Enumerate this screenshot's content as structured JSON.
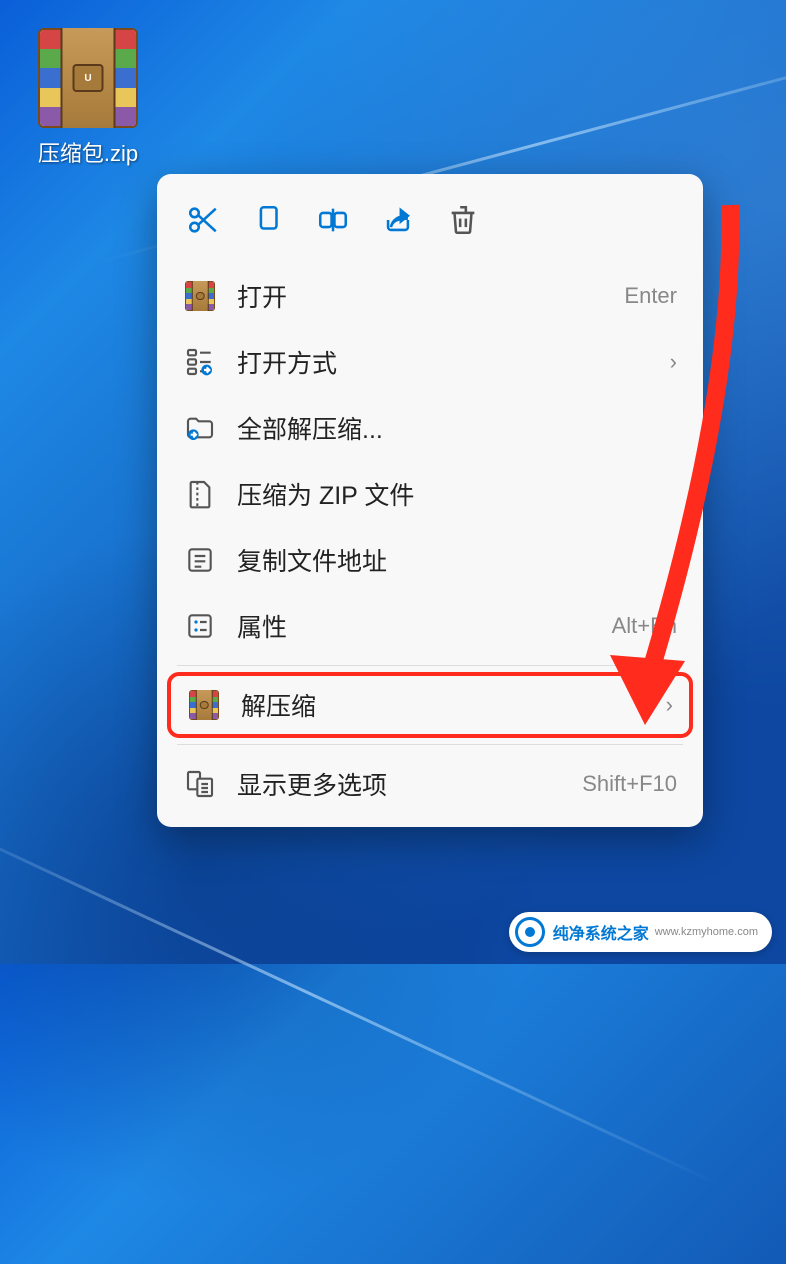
{
  "desktop": {
    "file_label": "压缩包.zip"
  },
  "context_menu": {
    "toolbar": {
      "cut": "cut",
      "copy": "copy",
      "rename": "rename",
      "share": "share",
      "delete": "delete"
    },
    "items": [
      {
        "label": "打开",
        "shortcut": "Enter",
        "icon": "winrar",
        "chevron": false
      },
      {
        "label": "打开方式",
        "shortcut": "",
        "icon": "openwith",
        "chevron": true
      },
      {
        "label": "全部解压缩...",
        "shortcut": "",
        "icon": "extract-all",
        "chevron": false
      },
      {
        "label": "压缩为 ZIP 文件",
        "shortcut": "",
        "icon": "zip",
        "chevron": false
      },
      {
        "label": "复制文件地址",
        "shortcut": "",
        "icon": "copy-path",
        "chevron": false
      },
      {
        "label": "属性",
        "shortcut": "Alt+En",
        "icon": "properties",
        "chevron": false
      },
      {
        "label": "解压缩",
        "shortcut": "",
        "icon": "winrar",
        "chevron": true,
        "highlighted": true
      },
      {
        "label": "显示更多选项",
        "shortcut": "Shift+F10",
        "icon": "more",
        "chevron": false
      }
    ]
  },
  "watermark": {
    "brand": "纯净系统之家",
    "url": "www.kzmyhome.com"
  }
}
